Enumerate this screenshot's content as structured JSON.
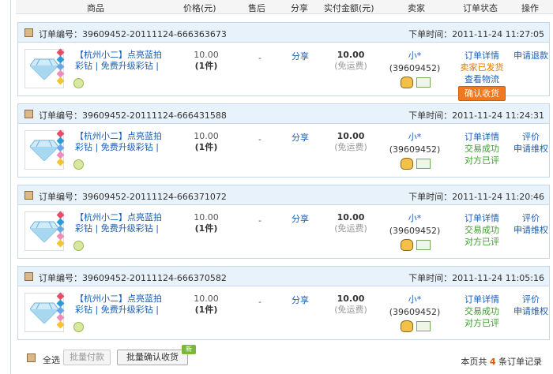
{
  "columns": [
    "商品",
    "价格(元)",
    "售后",
    "分享",
    "实付金额(元)",
    "卖家",
    "订单状态",
    "操作"
  ],
  "orders": [
    {
      "order_no": "订单编号：39609452-20111124-666363673",
      "time": "下单时间：2011-11-24 11:27:05",
      "name": "【杭州小二】点亮蓝拍彩钻 | 免费升级彩钻 |",
      "price": "10.00",
      "qty": "(1件)",
      "after": "-",
      "share": "分享",
      "amount": "10.00",
      "shipping": "(免运费)",
      "seller_name": "小*",
      "seller_id": "(39609452)",
      "status": [
        "订单详情",
        "卖家已发货",
        "查看物流"
      ],
      "confirm_label": "确认收货",
      "ops": [
        "申请退款"
      ]
    },
    {
      "order_no": "订单编号：39609452-20111124-666431588",
      "time": "下单时间：2011-11-24 11:24:31",
      "name": "【杭州小二】点亮蓝拍彩钻 | 免费升级彩钻 |",
      "price": "10.00",
      "qty": "(1件)",
      "after": "-",
      "share": "分享",
      "amount": "10.00",
      "shipping": "(免运费)",
      "seller_name": "小*",
      "seller_id": "(39609452)",
      "status": [
        "订单详情",
        "交易成功",
        "对方已评"
      ],
      "ops": [
        "评价",
        "申请维权"
      ]
    },
    {
      "order_no": "订单编号：39609452-20111124-666371072",
      "time": "下单时间：2011-11-24 11:20:46",
      "name": "【杭州小二】点亮蓝拍彩钻 | 免费升级彩钻 |",
      "price": "10.00",
      "qty": "(1件)",
      "after": "-",
      "share": "分享",
      "amount": "10.00",
      "shipping": "(免运费)",
      "seller_name": "小*",
      "seller_id": "(39609452)",
      "status": [
        "订单详情",
        "交易成功",
        "对方已评"
      ],
      "ops": [
        "评价",
        "申请维权"
      ]
    },
    {
      "order_no": "订单编号：39609452-20111124-666370582",
      "time": "下单时间：2011-11-24 11:05:16",
      "name": "【杭州小二】点亮蓝拍彩钻 | 免费升级彩钻 |",
      "price": "10.00",
      "qty": "(1件)",
      "after": "-",
      "share": "分享",
      "amount": "10.00",
      "shipping": "(免运费)",
      "seller_name": "小*",
      "seller_id": "(39609452)",
      "status": [
        "订单详情",
        "交易成功",
        "对方已评"
      ],
      "ops": [
        "评价",
        "申请维权"
      ]
    }
  ],
  "footer": {
    "select_all": "全选",
    "batch_pay": "批量付款",
    "batch_confirm": "批量确认收货",
    "new_badge": "新",
    "summary_prefix": "本页共",
    "summary_count": "4",
    "summary_suffix": "条订单记录"
  },
  "colors": {
    "link": "#1a5fb4",
    "success": "#3c9c2c",
    "shipped": "#e07c00",
    "confirm_button": "#f07820",
    "header_bg": "#e8f2fb"
  },
  "icons": [
    "diamond-icon",
    "gem-stack-icon",
    "wangwang-icon",
    "qq-icon",
    "business-card-icon",
    "checkbox-icon"
  ]
}
